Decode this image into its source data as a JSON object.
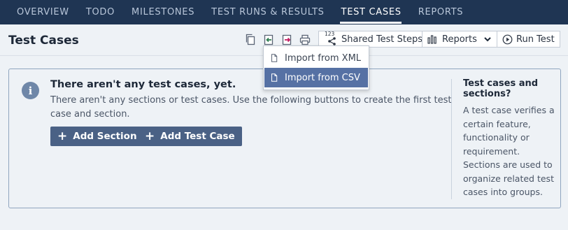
{
  "nav": {
    "tabs": [
      {
        "label": "OVERVIEW"
      },
      {
        "label": "TODO"
      },
      {
        "label": "MILESTONES"
      },
      {
        "label": "TEST RUNS & RESULTS"
      },
      {
        "label": "TEST CASES",
        "active": true
      },
      {
        "label": "REPORTS"
      }
    ]
  },
  "header": {
    "title": "Test Cases",
    "icons": [
      "copy-icon",
      "import-icon",
      "export-icon",
      "print-icon"
    ],
    "shared_steps_badge": "123",
    "shared_steps_label": "Shared Test Steps",
    "reports_label": "Reports",
    "run_test_label": "Run Test"
  },
  "import_menu": {
    "items": [
      {
        "label": "Import from XML"
      },
      {
        "label": "Import from CSV",
        "highlighted": true
      }
    ]
  },
  "empty_state": {
    "title": "There aren't any test cases, yet.",
    "description": "There aren't any sections or test cases. Use the following buttons to create the first test case and section.",
    "add_section_label": "Add Section",
    "add_test_case_label": "Add Test Case"
  },
  "sidebar_help": {
    "title": "Test cases and sections?",
    "text": "A test case verifies a certain feature, functionality or requirement. Sections are used to organize related test cases into groups."
  },
  "colors": {
    "nav_background": "#1f3553",
    "page_background": "#eef2f6",
    "primary_button": "#4a6185",
    "menu_highlight": "#5671a4",
    "import_accent": "#2e7d4f",
    "export_accent": "#c0185f"
  }
}
